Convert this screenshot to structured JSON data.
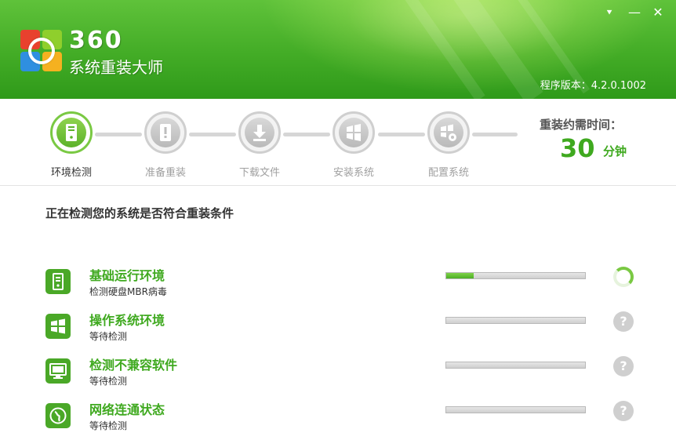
{
  "app": {
    "brand_num": "360",
    "brand_name": "系统重装大师",
    "version": "程序版本：4.2.0.1002"
  },
  "window_controls": {
    "menu": "⯆",
    "minimize": "—",
    "close": "✕"
  },
  "steps": [
    {
      "label": "环境检测",
      "icon": "computer-tower-icon",
      "active": true
    },
    {
      "label": "准备重装",
      "icon": "exclamation-box-icon",
      "active": false
    },
    {
      "label": "下载文件",
      "icon": "download-arrow-icon",
      "active": false
    },
    {
      "label": "安装系统",
      "icon": "windows-logo-icon",
      "active": false
    },
    {
      "label": "配置系统",
      "icon": "windows-gear-icon",
      "active": false
    }
  ],
  "time": {
    "title": "重装约需时间：",
    "value": "30",
    "unit": "分钟"
  },
  "main": {
    "title": "正在检测您的系统是否符合重装条件"
  },
  "checks": [
    {
      "name": "基础运行环境",
      "status": "检测硬盘MBR病毒",
      "progress": 0.2,
      "state": "running",
      "icon": "computer-tower-icon"
    },
    {
      "name": "操作系统环境",
      "status": "等待检测",
      "progress": 0,
      "state": "pending",
      "icon": "windows-logo-icon"
    },
    {
      "name": "检测不兼容软件",
      "status": "等待检测",
      "progress": 0,
      "state": "pending",
      "icon": "monitor-icon"
    },
    {
      "name": "网络连通状态",
      "status": "等待检测",
      "progress": 0,
      "state": "pending",
      "icon": "globe-icon"
    }
  ],
  "pending_symbol": "?",
  "colors": {
    "brand_green": "#3fa91f",
    "header_green": "#43ac26",
    "inactive_gray": "#cfcfcf"
  }
}
